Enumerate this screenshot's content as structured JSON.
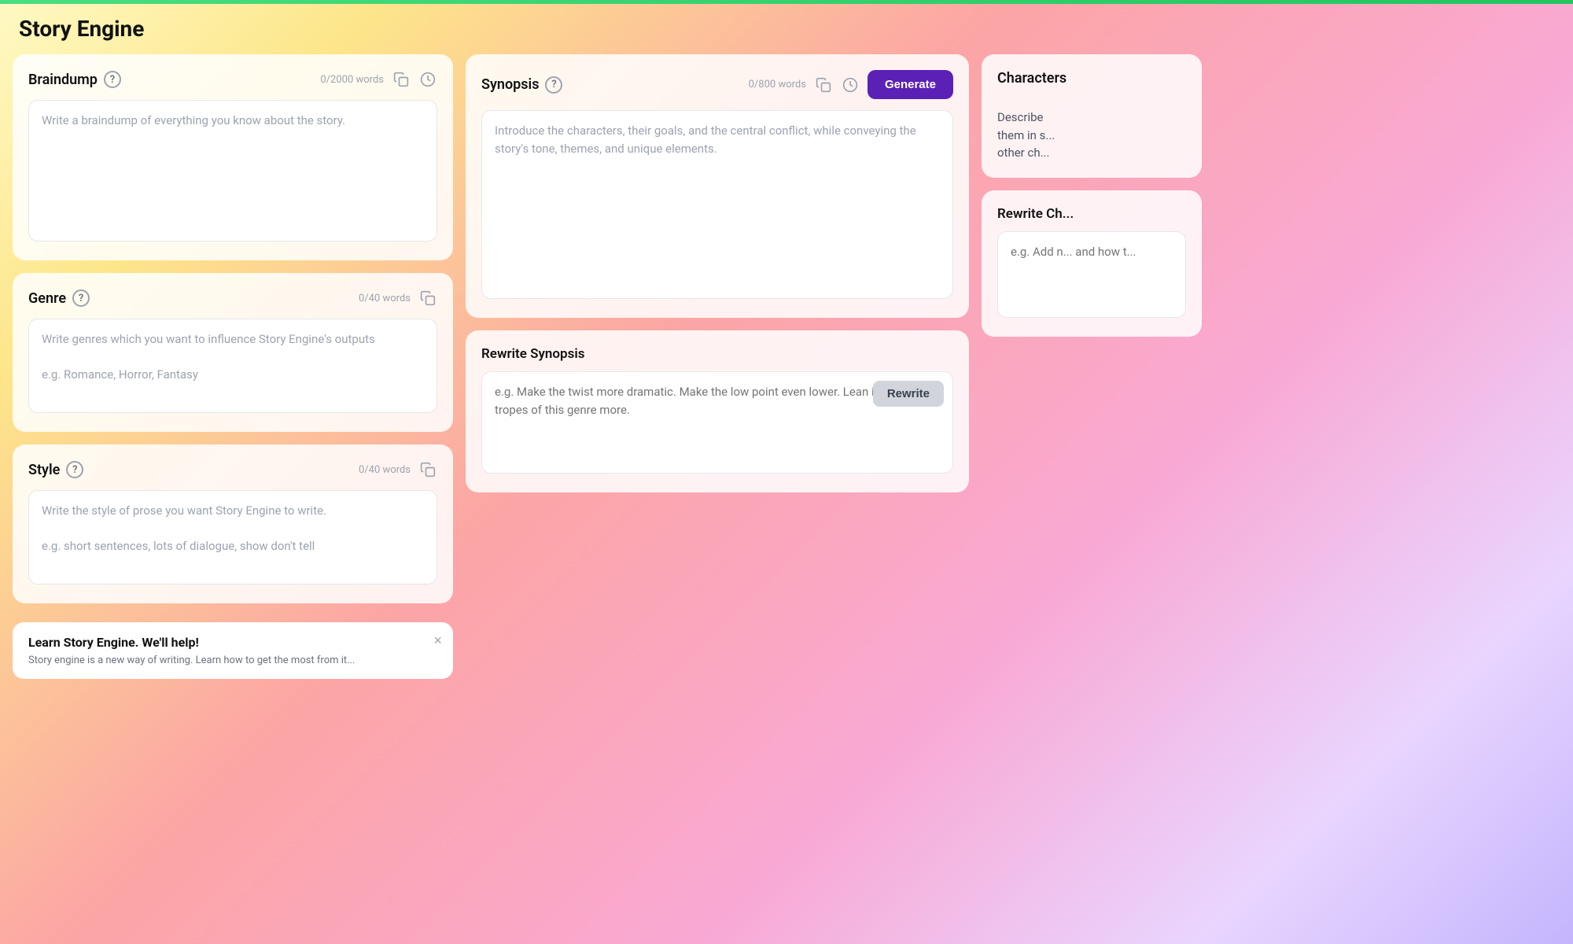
{
  "topBar": {
    "color": "#4ade80"
  },
  "appTitle": "Story Engine",
  "braindump": {
    "title": "Braindump",
    "wordCount": "0/2000 words",
    "placeholder": "Write a braindump of everything you know about the story."
  },
  "genre": {
    "title": "Genre",
    "wordCount": "0/40 words",
    "placeholder": "Write genres which you want to influence Story Engine's outputs\n\ne.g. Romance, Horror, Fantasy"
  },
  "style": {
    "title": "Style",
    "wordCount": "0/40 words",
    "placeholder": "Write the style of prose you want Story Engine to write.\n\ne.g. short sentences, lots of dialogue, show don't tell"
  },
  "synopsis": {
    "title": "Synopsis",
    "wordCount": "0/800 words",
    "generateLabel": "Generate",
    "placeholder": "Introduce the characters, their goals, and the central conflict, while conveying the story's tone, themes, and unique elements.",
    "rewriteTitle": "Rewrite Synopsis",
    "rewritePlaceholder": "e.g. Make the twist more dramatic. Make the low point even lower. Lean into the tropes of this genre more.",
    "rewriteLabel": "Rewrite"
  },
  "characters": {
    "title": "Characters",
    "placeholder": "Describe them in s... other ch...",
    "rewriteTitle": "Rewrite Ch...",
    "rewritePlaceholder": "e.g. Add n... and how t..."
  },
  "notification": {
    "title": "Learn Story Engine. We'll help!",
    "text": "Story engine is a new way of writing. Learn how to get the most from it...",
    "closeLabel": "×"
  },
  "icons": {
    "copy": "⧉",
    "history": "🕐",
    "help": "?"
  }
}
